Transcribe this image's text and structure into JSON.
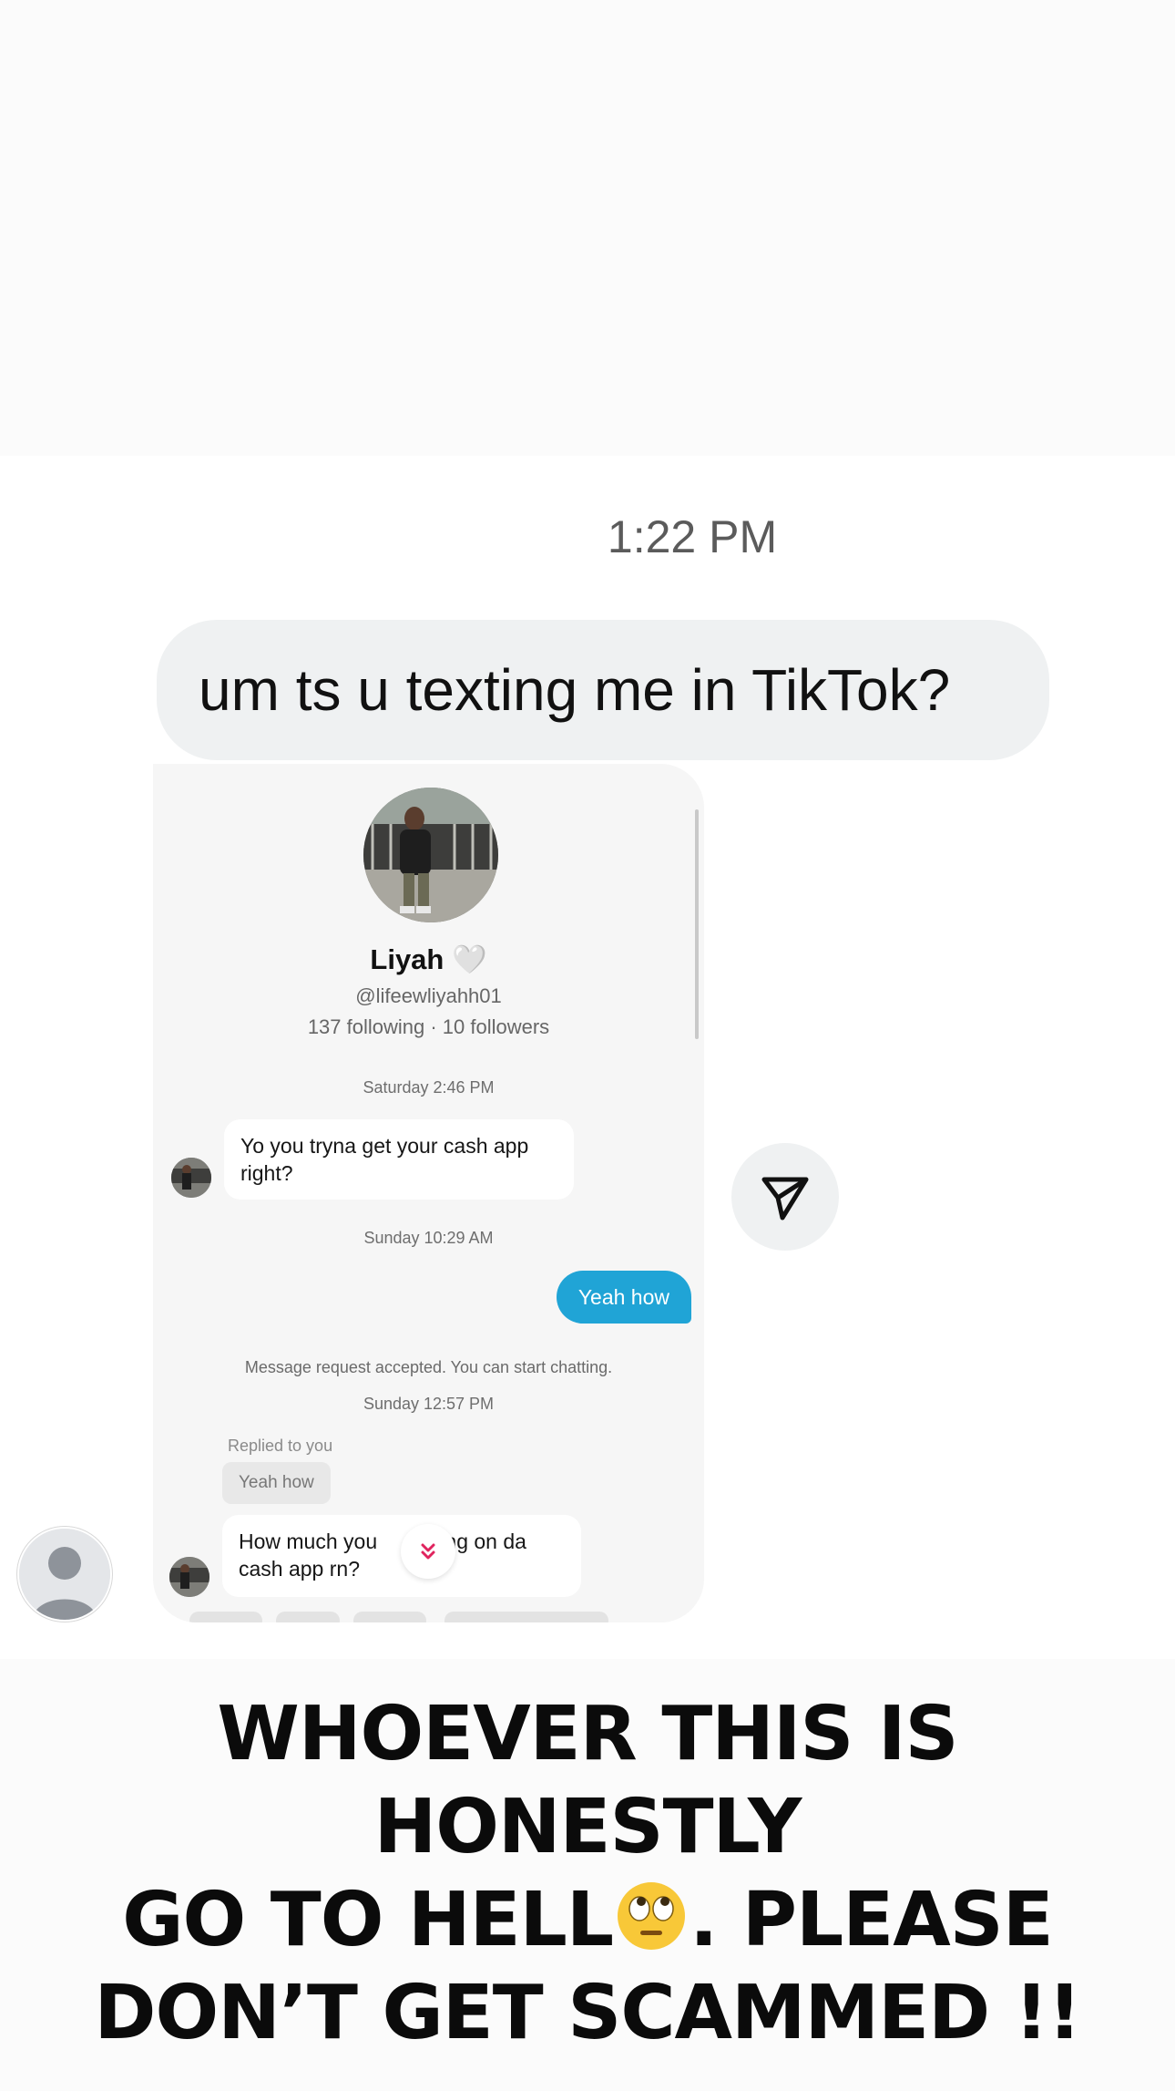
{
  "message_time": "1:22 PM",
  "reply_text": "um ts u texting me in TikTok?",
  "shared_screenshot": {
    "profile": {
      "name": "Liyah",
      "heart": "🤍",
      "handle": "@lifeewliyahh01",
      "stats": "137 following · 10 followers"
    },
    "chat": {
      "time_1": "Saturday 2:46 PM",
      "incoming_1": "Yo you tryna get your cash app right?",
      "time_2": "Sunday 10:29 AM",
      "outgoing_1": "Yeah how",
      "system_message": "Message request accepted. You can start chatting.",
      "time_3": "Sunday 12:57 PM",
      "replied_label": "Replied to you",
      "quoted_text": "Yeah how",
      "incoming_2_part1": "How much you ",
      "incoming_2_part2": "tting on da cash app rn?"
    },
    "scroll_down_icon": "double-chevron-down-icon"
  },
  "caption": {
    "line1": "WHOEVER THIS IS HONESTLY",
    "line2_before_emoji": "GO TO HELL",
    "emoji": "face-with-rolling-eyes",
    "line2_after_emoji": ". PLEASE",
    "line3": "DON’T GET SCAMMED !!"
  },
  "icons": {
    "send": "paper-plane-icon",
    "sender_avatar": "default-avatar-icon"
  },
  "colors": {
    "outgoing_bubble": "#20a4d6",
    "reply_bubble": "#eff1f2",
    "scroll_chevron": "#e0245e"
  }
}
